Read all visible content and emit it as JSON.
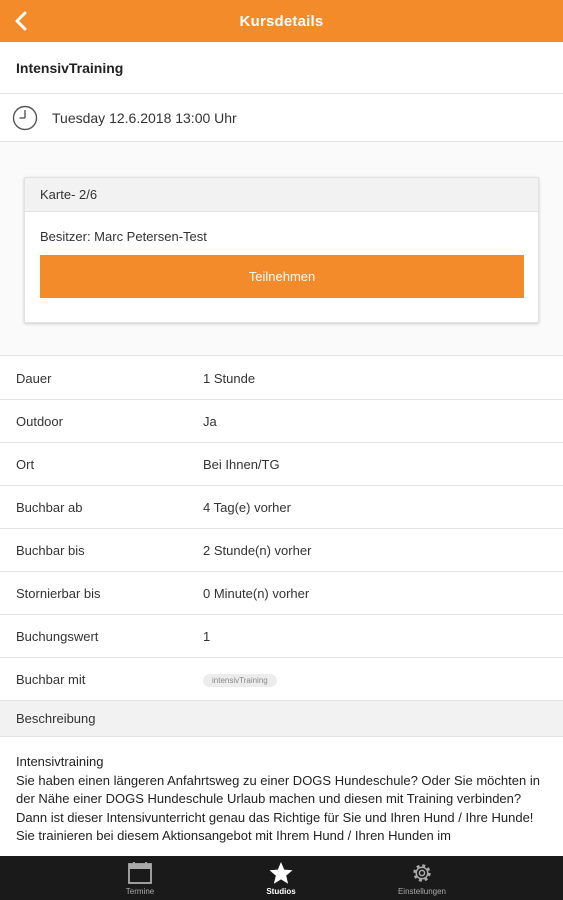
{
  "header": {
    "title": "Kursdetails",
    "back_icon": "chevron-left-icon"
  },
  "course": {
    "name": "IntensivTraining"
  },
  "datetime": {
    "text": "Tuesday 12.6.2018 13:00 Uhr",
    "icon": "clock-icon"
  },
  "card": {
    "title": "Karte- 2/6",
    "owner": "Besitzer: Marc Petersen-Test",
    "join_label": "Teilnehmen"
  },
  "details": [
    {
      "label": "Dauer",
      "value": "1 Stunde"
    },
    {
      "label": "Outdoor",
      "value": "Ja"
    },
    {
      "label": "Ort",
      "value": "Bei Ihnen/TG"
    },
    {
      "label": "Buchbar ab",
      "value": "4 Tag(e) vorher"
    },
    {
      "label": "Buchbar bis",
      "value": "2 Stunde(n) vorher"
    },
    {
      "label": "Stornierbar bis",
      "value": "0 Minute(n) vorher"
    },
    {
      "label": "Buchungswert",
      "value": "1"
    },
    {
      "label": "Buchbar mit",
      "value": "intensivTraining"
    }
  ],
  "description": {
    "heading": "Beschreibung",
    "lines": [
      "Intensivtraining",
      "Sie haben einen längeren Anfahrtsweg zu einer DOGS Hundeschule? Oder Sie möchten in der Nähe einer DOGS Hundeschule Urlaub machen und diesen mit Training verbinden? Dann ist dieser Intensivunterricht genau das Richtige für Sie und Ihren Hund / Ihre Hunde!",
      "Sie trainieren bei diesem Aktionsangebot mit Ihrem Hund / Ihren Hunden im"
    ]
  },
  "bottom_nav": [
    {
      "label": "Termine",
      "icon": "calendar-icon",
      "active": false
    },
    {
      "label": "Studios",
      "icon": "star-icon",
      "active": true
    },
    {
      "label": "Einstellungen",
      "icon": "gear-icon",
      "active": false
    }
  ],
  "colors": {
    "accent": "#f38b2a",
    "nav_bg": "#1a1a1a"
  }
}
